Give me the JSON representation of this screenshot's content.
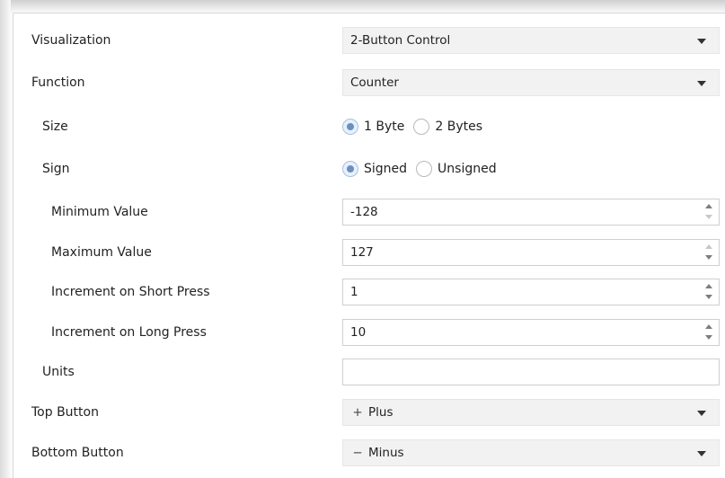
{
  "rows": {
    "visualization": {
      "label": "Visualization",
      "value": "2-Button Control"
    },
    "function": {
      "label": "Function",
      "value": "Counter"
    },
    "size": {
      "label": "Size",
      "options": [
        "1 Byte",
        "2 Bytes"
      ],
      "selected": "1 Byte"
    },
    "sign": {
      "label": "Sign",
      "options": [
        "Signed",
        "Unsigned"
      ],
      "selected": "Signed"
    },
    "min": {
      "label": "Minimum Value",
      "value": "-128"
    },
    "max": {
      "label": "Maximum Value",
      "value": "127"
    },
    "short": {
      "label": "Increment on Short Press",
      "value": "1"
    },
    "long": {
      "label": "Increment on Long Press",
      "value": "10"
    },
    "units": {
      "label": "Units",
      "value": ""
    },
    "top": {
      "label": "Top Button",
      "symbol": "+",
      "value": "Plus"
    },
    "bottom": {
      "label": "Bottom Button",
      "symbol": "−",
      "value": "Minus"
    }
  },
  "colors": {
    "select_bg": "#f2f2f2",
    "radio_accent": "#6b8fbf",
    "border": "#cfcfcf"
  }
}
